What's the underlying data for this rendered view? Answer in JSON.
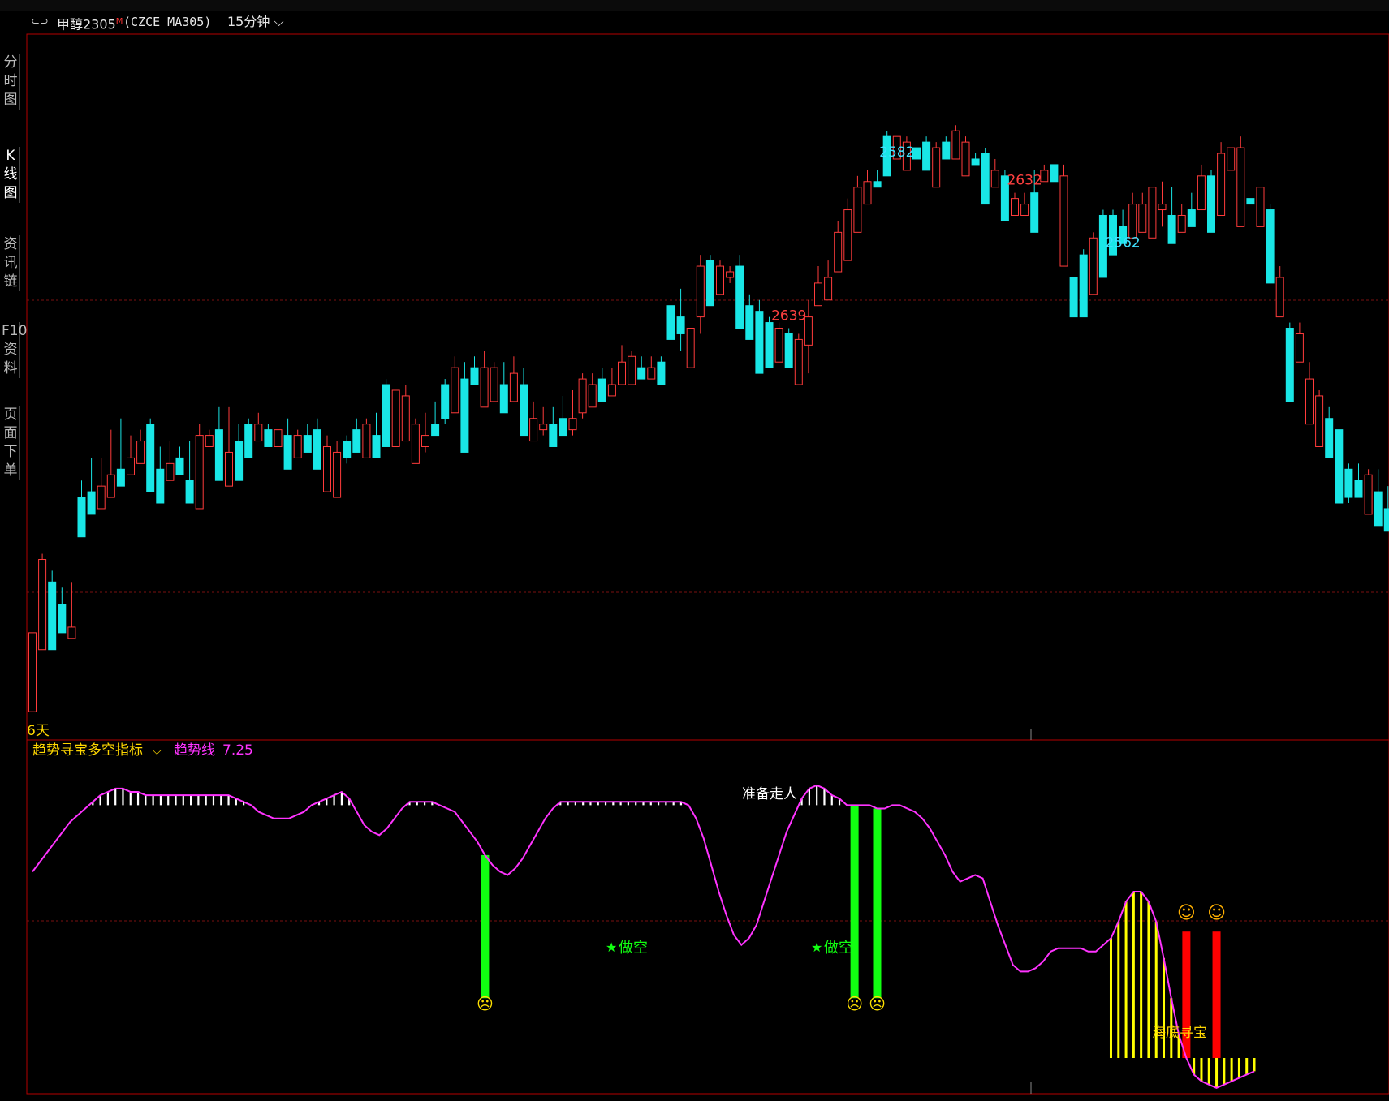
{
  "header": {
    "symbol": "甲醇2305",
    "symbol_mark": "M",
    "code": "(CZCE MA305)",
    "period": "15分钟"
  },
  "sidebar": {
    "tabs": [
      "分时图",
      "K线图",
      "资讯链",
      "F10资料",
      "页面下单"
    ]
  },
  "colors": {
    "up": "#ff3b3b",
    "down": "#19e6e6",
    "trend_line": "#ff33ff",
    "border": "#b40000",
    "sell_bar": "#11ff11",
    "buy_bar": "#ff0000",
    "bottom_fill": "#ffff00",
    "label_high": "#ff4040",
    "label_low": "#3fe0ff"
  },
  "chart_data": [
    {
      "type": "candlestick",
      "title": "甲醇2305 15分钟",
      "days_label": "6天",
      "annotations": [
        {
          "text": "2639",
          "kind": "high"
        },
        {
          "text": "2632",
          "kind": "high"
        },
        {
          "text": "2582",
          "kind": "low"
        },
        {
          "text": "2562",
          "kind": "low"
        }
      ],
      "ylim": [
        2531,
        2654
      ],
      "candles": [
        [
          2540,
          2535,
          2549,
          2545
        ],
        [
          2553,
          2546,
          2562,
          2563
        ],
        [
          2555,
          2546,
          2558,
          2560
        ],
        [
          2551,
          2549,
          2554,
          2557
        ],
        [
          2549,
          2548,
          2550,
          2558
        ],
        [
          2572,
          2566,
          2573,
          2576
        ],
        [
          2573,
          2570,
          2574,
          2580
        ],
        [
          2573,
          2571,
          2575,
          2580
        ],
        [
          2576,
          2573,
          2577,
          2585
        ],
        [
          2578,
          2575,
          2578,
          2587
        ],
        [
          2578,
          2577,
          2580,
          2584
        ],
        [
          2582,
          2579,
          2583,
          2585
        ],
        [
          2584,
          2574,
          2586,
          2587
        ],
        [
          2574,
          2572,
          2578,
          2582
        ],
        [
          2578,
          2576,
          2579,
          2583
        ],
        [
          2579,
          2577,
          2580,
          2582
        ],
        [
          2575,
          2572,
          2576,
          2583
        ],
        [
          2582,
          2571,
          2584,
          2586
        ],
        [
          2583,
          2582,
          2584,
          2585
        ],
        [
          2583,
          2576,
          2585,
          2589
        ],
        [
          2580,
          2575,
          2581,
          2589
        ],
        [
          2580,
          2576,
          2583,
          2586
        ],
        [
          2583,
          2580,
          2586,
          2587
        ],
        [
          2585,
          2583,
          2586,
          2588
        ],
        [
          2584,
          2582,
          2585,
          2586
        ],
        [
          2584,
          2582,
          2585,
          2587
        ],
        [
          2583,
          2578,
          2584,
          2587
        ],
        [
          2580,
          2580,
          2584,
          2585
        ],
        [
          2583,
          2581,
          2584,
          2586
        ],
        [
          2584,
          2578,
          2585,
          2587
        ],
        [
          2580,
          2574,
          2582,
          2584
        ],
        [
          2576,
          2573,
          2581,
          2583
        ],
        [
          2579,
          2580,
          2583,
          2584
        ],
        [
          2583,
          2581,
          2585,
          2587
        ],
        [
          2585,
          2580,
          2586,
          2587
        ],
        [
          2583,
          2580,
          2584,
          2588
        ],
        [
          2587,
          2582,
          2593,
          2594
        ],
        [
          2591,
          2582,
          2592,
          2592
        ],
        [
          2588,
          2583,
          2591,
          2593
        ],
        [
          2584,
          2579,
          2586,
          2587
        ],
        [
          2581,
          2582,
          2584,
          2588
        ],
        [
          2584,
          2584,
          2586,
          2590
        ],
        [
          2586,
          2587,
          2593,
          2594
        ],
        [
          2593,
          2588,
          2596,
          2598
        ],
        [
          2592,
          2581,
          2594,
          2597
        ],
        [
          2595,
          2593,
          2596,
          2598
        ],
        [
          2595,
          2589,
          2596,
          2599
        ],
        [
          2592,
          2590,
          2596,
          2597
        ],
        [
          2591,
          2588,
          2593,
          2597
        ],
        [
          2593,
          2590,
          2595,
          2598
        ],
        [
          2591,
          2584,
          2593,
          2596
        ],
        [
          2586,
          2583,
          2587,
          2590
        ],
        [
          2584,
          2585,
          2586,
          2589
        ],
        [
          2585,
          2582,
          2586,
          2589
        ],
        [
          2585,
          2584,
          2587,
          2591
        ],
        [
          2584,
          2585,
          2587,
          2592
        ],
        [
          2587,
          2588,
          2594,
          2595
        ],
        [
          2592,
          2589,
          2593,
          2595
        ],
        [
          2593,
          2590,
          2594,
          2596
        ],
        [
          2592,
          2591,
          2593,
          2596
        ],
        [
          2596,
          2593,
          2597,
          2600
        ],
        [
          2596,
          2593,
          2598,
          2599
        ],
        [
          2595,
          2594,
          2596,
          2598
        ],
        [
          2595,
          2594,
          2596,
          2598
        ],
        [
          2593,
          2593,
          2597,
          2598
        ],
        [
          2606,
          2601,
          2607,
          2608
        ],
        [
          2599,
          2602,
          2605,
          2610
        ],
        [
          2601,
          2596,
          2603,
          2603
        ],
        [
          2602,
          2605,
          2614,
          2616
        ],
        [
          2614,
          2607,
          2615,
          2616
        ],
        [
          2609,
          2609,
          2614,
          2615
        ],
        [
          2611,
          2612,
          2613,
          2614
        ],
        [
          2613,
          2603,
          2614,
          2616
        ],
        [
          2605,
          2601,
          2607,
          2609
        ],
        [
          2601,
          2595,
          2606,
          2608
        ],
        [
          2602,
          2596,
          2604,
          2605
        ],
        [
          2599,
          2597,
          2603,
          2604
        ],
        [
          2601,
          2596,
          2602,
          2603
        ],
        [
          2594,
          2593,
          2601,
          2602
        ],
        [
          2595,
          2600,
          2605,
          2608
        ],
        [
          2608,
          2607,
          2611,
          2614
        ],
        [
          2611,
          2608,
          2612,
          2615
        ],
        [
          2615,
          2613,
          2620,
          2622
        ],
        [
          2620,
          2615,
          2624,
          2626
        ],
        [
          2623,
          2620,
          2628,
          2630
        ],
        [
          2626,
          2625,
          2629,
          2631
        ],
        [
          2629,
          2628,
          2629,
          2631
        ],
        [
          2637,
          2630,
          2637,
          2638
        ],
        [
          2636,
          2633,
          2637,
          2637
        ],
        [
          2634,
          2631,
          2636,
          2637
        ],
        [
          2634,
          2633,
          2635,
          2635
        ],
        [
          2634,
          2631,
          2636,
          2637
        ],
        [
          2634,
          2628,
          2635,
          2636
        ],
        [
          2634,
          2633,
          2636,
          2637
        ],
        [
          2637,
          2633,
          2638,
          2639
        ],
        [
          2633,
          2630,
          2636,
          2637
        ],
        [
          2633,
          2632,
          2633,
          2634
        ],
        [
          2627,
          2625,
          2634,
          2635
        ],
        [
          2628,
          2628,
          2631,
          2633
        ],
        [
          2627,
          2622,
          2630,
          2631
        ],
        [
          2624,
          2623,
          2626,
          2627
        ],
        [
          2624,
          2623,
          2625,
          2627
        ],
        [
          2621,
          2620,
          2627,
          2631
        ],
        [
          2631,
          2629,
          2631,
          2632
        ],
        [
          2629,
          2629,
          2632,
          2632
        ],
        [
          2627,
          2614,
          2630,
          2632
        ],
        [
          2612,
          2605,
          2612,
          2612
        ],
        [
          2609,
          2605,
          2616,
          2617
        ],
        [
          2613,
          2609,
          2619,
          2620
        ],
        [
          2613,
          2612,
          2623,
          2624
        ],
        [
          2621,
          2616,
          2623,
          2624
        ],
        [
          2620,
          2618,
          2621,
          2624
        ],
        [
          2619,
          2619,
          2625,
          2627
        ],
        [
          2623,
          2620,
          2625,
          2627
        ],
        [
          2623,
          2619,
          2628,
          2628
        ],
        [
          2621,
          2624,
          2625,
          2629
        ],
        [
          2621,
          2618,
          2623,
          2628
        ],
        [
          2622,
          2620,
          2623,
          2625
        ],
        [
          2621,
          2621,
          2624,
          2627
        ],
        [
          2624,
          2624,
          2630,
          2632
        ],
        [
          2627,
          2620,
          2630,
          2631
        ],
        [
          2629,
          2623,
          2634,
          2636
        ],
        [
          2633,
          2631,
          2635,
          2635
        ],
        [
          2626,
          2621,
          2635,
          2637
        ],
        [
          2625,
          2625,
          2626,
          2626
        ],
        [
          2624,
          2621,
          2628,
          2628
        ],
        [
          2614,
          2611,
          2624,
          2625
        ],
        [
          2610,
          2605,
          2612,
          2614
        ],
        [
          2603,
          2590,
          2603,
          2604
        ],
        [
          2599,
          2597,
          2602,
          2604
        ],
        [
          2592,
          2586,
          2594,
          2597
        ],
        [
          2585,
          2582,
          2591,
          2592
        ],
        [
          2584,
          2580,
          2587,
          2589
        ],
        [
          2583,
          2572,
          2585,
          2585
        ],
        [
          2572,
          2573,
          2578,
          2579
        ],
        [
          2575,
          2573,
          2576,
          2579
        ],
        [
          2575,
          2570,
          2577,
          2578
        ],
        [
          2572,
          2568,
          2574,
          2578
        ],
        [
          2570,
          2567,
          2571,
          2575
        ],
        [
          2573,
          2568,
          2576,
          2578
        ],
        [
          2573,
          2571,
          2575,
          2578
        ],
        [
          2577,
          2575,
          2578,
          2579
        ]
      ],
      "candle_dirs": "uuddudduuduuddudduududdudududduuddudduuuuddudduududuudduuuduuududdduuduudddduduuuuuuuudduudduduudduduudududduddduuuudududuuudududuuudddduddddududduudu"
    },
    {
      "type": "line",
      "title": "趋势寻宝多空指标",
      "series": [
        {
          "name": "趋势线",
          "value_label": "7.25"
        }
      ],
      "signals": [
        {
          "text": "做空",
          "kind": "sell"
        },
        {
          "text": "做空",
          "kind": "sell"
        },
        {
          "text": "准备走人",
          "kind": "warning"
        },
        {
          "text": "海底寻宝",
          "kind": "bottom"
        }
      ],
      "ylim": [
        0,
        100
      ],
      "trend": [
        66,
        69,
        72,
        75,
        78,
        81,
        83,
        85,
        87,
        89,
        90,
        91,
        91,
        90,
        90,
        89,
        89,
        89,
        89,
        89,
        89,
        89,
        89,
        89,
        89,
        89,
        89,
        88,
        87,
        86,
        84,
        83,
        82,
        82,
        82,
        83,
        84,
        86,
        87,
        88,
        89,
        90,
        88,
        84,
        80,
        78,
        77,
        79,
        82,
        85,
        87,
        87,
        87,
        87,
        86,
        85,
        84,
        81,
        78,
        75,
        71,
        68,
        66,
        65,
        67,
        70,
        74,
        78,
        82,
        85,
        87,
        87,
        87,
        87,
        87,
        87,
        87,
        87,
        87,
        87,
        87,
        87,
        87,
        87,
        87,
        87,
        87,
        86,
        82,
        76,
        68,
        60,
        53,
        47,
        44,
        46,
        50,
        57,
        64,
        71,
        78,
        83,
        88,
        91,
        92,
        91,
        89,
        88,
        86,
        86,
        86,
        86,
        85,
        85,
        86,
        86,
        85,
        84,
        82,
        79,
        75,
        71,
        66,
        63,
        64,
        65,
        64,
        57,
        50,
        44,
        38,
        36,
        36,
        37,
        39,
        42,
        43,
        43,
        43,
        43,
        42,
        42,
        44,
        46,
        51,
        57,
        60,
        60,
        57,
        51,
        40,
        28,
        17,
        10,
        5,
        3,
        2,
        1,
        2,
        3,
        4,
        5,
        6
      ]
    }
  ]
}
